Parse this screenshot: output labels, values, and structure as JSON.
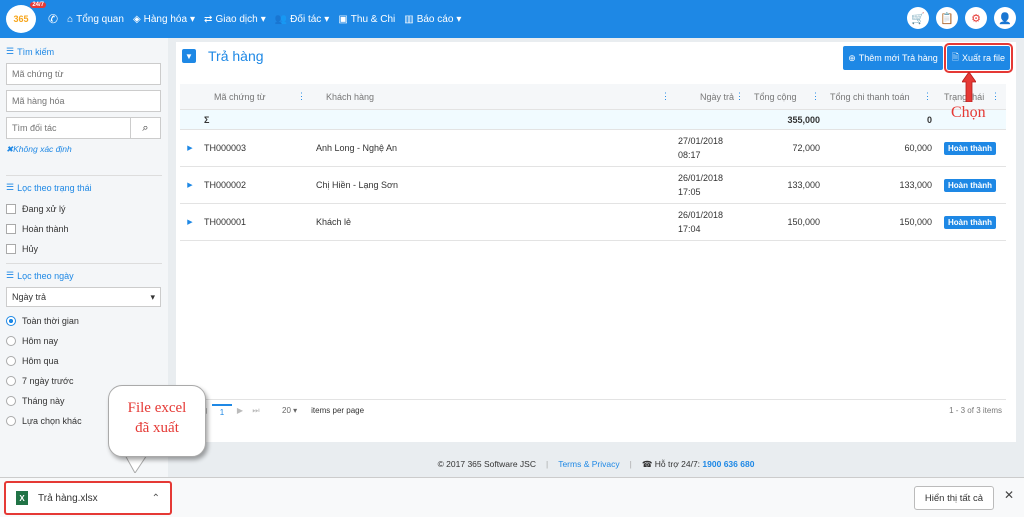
{
  "nav": {
    "logo": "365",
    "logo_badge": "24/7",
    "items": [
      {
        "icon": "home-icon",
        "label": "Tổng quan"
      },
      {
        "icon": "cubes-icon",
        "label": "Hàng hóa"
      },
      {
        "icon": "exchange-icon",
        "label": "Giao dịch"
      },
      {
        "icon": "users-icon",
        "label": "Đối tác"
      },
      {
        "icon": "money-icon",
        "label": "Thu & Chi"
      },
      {
        "icon": "chart-icon",
        "label": "Báo cáo"
      }
    ],
    "right_icons": [
      "cart-icon",
      "clipboard-icon",
      "gear-icon",
      "user-icon"
    ]
  },
  "sidebar": {
    "search": {
      "title": "Tìm kiếm",
      "doc_code_placeholder": "Mã chứng từ",
      "product_code_placeholder": "Mã hàng hóa",
      "partner_placeholder": "Tìm đối tác",
      "note": "Không xác định"
    },
    "status_filter": {
      "title": "Lọc theo trạng thái",
      "options": [
        "Đang xử lý",
        "Hoàn thành",
        "Hủy"
      ]
    },
    "date_filter": {
      "title": "Lọc theo ngày",
      "select_value": "Ngày trả",
      "options": [
        "Toàn thời gian",
        "Hôm nay",
        "Hôm qua",
        "7 ngày trước",
        "Tháng này",
        "Lựa chọn khác"
      ],
      "selected_index": 0
    }
  },
  "main": {
    "title": "Trả hàng",
    "add_button": "Thêm mới Trả hàng",
    "export_button": "Xuất ra file",
    "columns": [
      "Mã chứng từ",
      "Khách hàng",
      "Ngày trả",
      "Tổng cộng",
      "Tổng chi thanh toán",
      "Trạng thái"
    ],
    "sum_row": {
      "symbol": "Σ",
      "total": "355,000",
      "paid": "0"
    },
    "rows": [
      {
        "code": "TH000003",
        "customer": "Anh Long - Nghệ An",
        "date": "27/01/2018",
        "time": "08:17",
        "total": "72,000",
        "paid": "60,000",
        "status": "Hoàn thành"
      },
      {
        "code": "TH000002",
        "customer": "Chị Hiền - Lạng Sơn",
        "date": "26/01/2018",
        "time": "17:05",
        "total": "133,000",
        "paid": "133,000",
        "status": "Hoàn thành"
      },
      {
        "code": "TH000001",
        "customer": "Khách lẻ",
        "date": "26/01/2018",
        "time": "17:04",
        "total": "150,000",
        "paid": "150,000",
        "status": "Hoàn thành"
      }
    ],
    "pager": {
      "current_page": "1",
      "page_size": "20",
      "page_size_label": "items per page",
      "info": "1 - 3 of 3 items"
    }
  },
  "footer": {
    "copyright": "© 2017 365 Software JSC",
    "terms": "Terms & Privacy",
    "support_label": "Hỗ trợ 24/7:",
    "support_phone": "1900 636 680"
  },
  "annotations": {
    "choose": "Chọn",
    "callout_line1": "File excel",
    "callout_line2": "đã xuất"
  },
  "download_bar": {
    "file_name": "Trả hàng.xlsx",
    "show_all": "Hiển thị tất cả"
  }
}
